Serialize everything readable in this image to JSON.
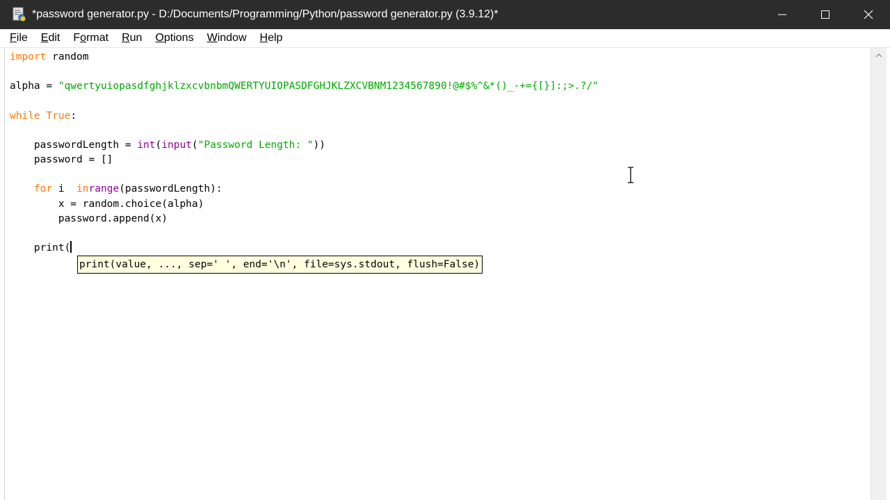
{
  "window": {
    "title": "*password generator.py - D:/Documents/Programming/Python/password generator.py (3.9.12)*",
    "controls": [
      "minimize-icon",
      "maximize-icon",
      "close-icon"
    ]
  },
  "menu": {
    "items": [
      {
        "label": "File",
        "ul": "F",
        "rest": "ile"
      },
      {
        "label": "Edit",
        "ul": "E",
        "rest": "dit"
      },
      {
        "label": "Format",
        "pre": "F",
        "ul": "o",
        "rest": "rmat"
      },
      {
        "label": "Run",
        "ul": "R",
        "rest": "un"
      },
      {
        "label": "Options",
        "ul": "O",
        "rest": "ptions"
      },
      {
        "label": "Window",
        "ul": "W",
        "rest": "indow"
      },
      {
        "label": "Help",
        "ul": "H",
        "rest": "elp"
      }
    ]
  },
  "editor": {
    "lines": [
      {
        "kw": "import",
        "rest": " random"
      },
      {
        "blank": true
      },
      {
        "a": "alpha = ",
        "s": "\"qwertyuiopasdfghjklzxcvbnbmQWERTYUIOPASDFGHJKLZXCVBNM1234567890!@#$%^&*()_-+={[}]:;>.?/\""
      },
      {
        "blank": true
      },
      {
        "kw1": "while",
        "sp": " ",
        "kw2": "True",
        "rest": ":"
      },
      {
        "blank": true
      },
      {
        "indent": "    ",
        "a": "passwordLength = ",
        "b1": "int",
        "p1": "(",
        "b2": "input",
        "p2": "(",
        "s": "\"Password Length: \"",
        "rest": "))"
      },
      {
        "indent": "    ",
        "a": "password = []"
      },
      {
        "blank": true
      },
      {
        "indent": "    ",
        "kw1": "for",
        "m": " i ",
        "kw2": "in",
        "sp": " ",
        "b1": "range",
        "rest": "(passwordLength):"
      },
      {
        "indent": "        ",
        "a": "x = random.choice(alpha)"
      },
      {
        "indent": "        ",
        "a": "password.append(x)"
      },
      {
        "blank": true
      },
      {
        "indent": "    ",
        "a": "print("
      }
    ]
  },
  "calltip": {
    "text": "print(value, ..., sep=' ', end='\\n', file=sys.stdout, flush=False)"
  },
  "colors": {
    "keyword": "#ff7700",
    "builtin": "#900090",
    "string": "#00aa00",
    "titlebar": "#2c2c2c",
    "calltip_bg": "#ffffe0"
  }
}
